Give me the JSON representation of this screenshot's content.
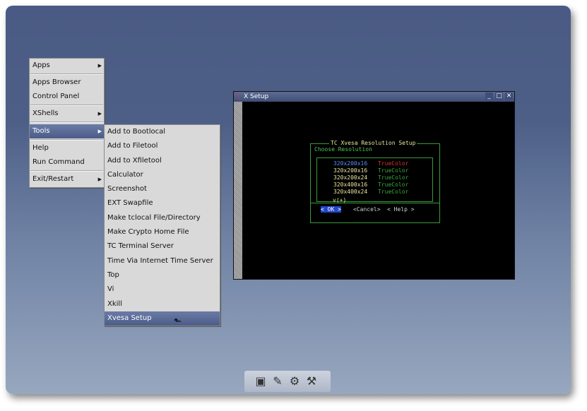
{
  "root_menu": {
    "items": [
      {
        "label": "Apps",
        "submenu": true
      },
      {
        "label": "Apps Browser",
        "submenu": false
      },
      {
        "label": "Control Panel",
        "submenu": false
      },
      {
        "label": "XShells",
        "submenu": true
      },
      {
        "label": "Tools",
        "submenu": true,
        "selected": true
      },
      {
        "label": "Help",
        "submenu": false
      },
      {
        "label": "Run Command",
        "submenu": false
      },
      {
        "label": "Exit/Restart",
        "submenu": true
      }
    ]
  },
  "tools_menu": {
    "items": [
      "Add to Bootlocal",
      "Add to Filetool",
      "Add to Xfiletool",
      "Calculator",
      "Screenshot",
      "EXT Swapfile",
      "Make tclocal File/Directory",
      "Make Crypto Home File",
      "TC Terminal Server",
      "Time Via Internet Time Server",
      "Top",
      "Vi",
      "Xkill",
      "Xvesa Setup"
    ],
    "selected": "Xvesa Setup"
  },
  "window": {
    "title": "X Setup",
    "dialog": {
      "title": "TC Xvesa Resolution Setup",
      "subtitle": "Choose Resolution",
      "options": [
        {
          "res": "320x200x16",
          "depth": "TrueColor",
          "color": "#e03030",
          "highlight": true
        },
        {
          "res": "320x200x16",
          "depth": "TrueColor",
          "color": "#3aa83a"
        },
        {
          "res": "320x200x24",
          "depth": "TrueColor",
          "color": "#3aa83a"
        },
        {
          "res": "320x400x16",
          "depth": "TrueColor",
          "color": "#3aa83a"
        },
        {
          "res": "320x400x24",
          "depth": "TrueColor",
          "color": "#3aa83a"
        }
      ],
      "more": "v(+)",
      "ok_label": "< OK >",
      "cancel_label": "<Cancel>",
      "help_label": "< Help >"
    }
  },
  "dock": {
    "icons": [
      "terminal-icon",
      "editor-icon",
      "control-panel-gears-icon",
      "tools-icon"
    ]
  },
  "colors": {
    "menu_bg": "#d9d9d9",
    "selection": "#4c5c89",
    "terminal_green": "#3a9a3a",
    "terminal_yellow": "#e6e6a0"
  }
}
